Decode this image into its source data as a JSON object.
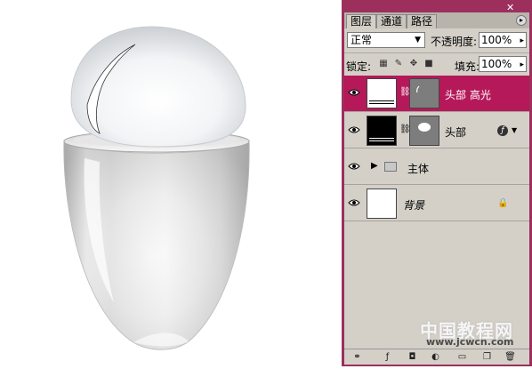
{
  "panel": {
    "tabs": [
      "图层",
      "通道",
      "路径"
    ],
    "blend_mode": "正常",
    "opacity_label": "不透明度:",
    "opacity_value": "100%",
    "lock_label": "锁定:",
    "fill_label": "填充:",
    "fill_value": "100%"
  },
  "layers": [
    {
      "name": "头部 高光",
      "selected": true,
      "has_mask": true
    },
    {
      "name": "头部",
      "selected": false,
      "has_mask": true,
      "has_effects": true
    },
    {
      "name": "主体",
      "type": "group"
    },
    {
      "name": "背景",
      "locked": true
    }
  ],
  "watermark": {
    "line1": "中国教程网",
    "line2": "www.jcwcn.com"
  },
  "colors": {
    "panel_frame": "#9c2f5c",
    "selected_layer": "#b5195a",
    "panel_bg": "#d4d0c8"
  }
}
